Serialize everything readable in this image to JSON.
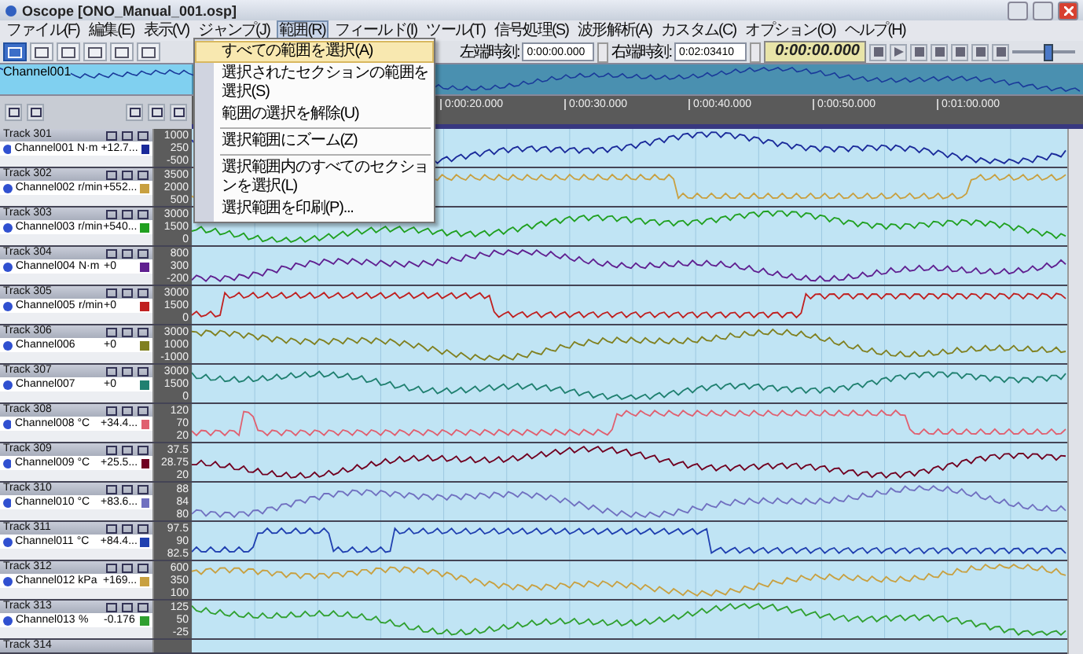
{
  "window": {
    "title": "Oscope [ONO_Manual_001.osp]"
  },
  "menu": [
    {
      "label": "ファイル(F)",
      "selected": false
    },
    {
      "label": "編集(E)",
      "selected": false
    },
    {
      "label": "表示(V)",
      "selected": false
    },
    {
      "label": "ジャンプ(J)",
      "selected": false
    },
    {
      "label": "範囲(R)",
      "selected": true
    },
    {
      "label": "フィールド(I)",
      "selected": false
    },
    {
      "label": "ツール(T)",
      "selected": false
    },
    {
      "label": "信号処理(S)",
      "selected": false
    },
    {
      "label": "波形解析(A)",
      "selected": false
    },
    {
      "label": "カスタム(C)",
      "selected": false
    },
    {
      "label": "オプション(O)",
      "selected": false
    },
    {
      "label": "ヘルプ(H)",
      "selected": false
    }
  ],
  "dropdown": [
    {
      "kind": "item",
      "label": "すべての範囲を選択(A)",
      "selected": true
    },
    {
      "kind": "item",
      "label": "選択されたセクションの範囲を選択(S)",
      "selected": false
    },
    {
      "kind": "item",
      "label": "範囲の選択を解除(U)",
      "selected": false
    },
    {
      "kind": "separator"
    },
    {
      "kind": "item",
      "label": "選択範囲にズーム(Z)",
      "selected": false
    },
    {
      "kind": "separator"
    },
    {
      "kind": "item",
      "label": "選択範囲内のすべてのセクションを選択(L)",
      "selected": false
    },
    {
      "kind": "item",
      "label": "選択範囲を印刷(P)...",
      "selected": false
    }
  ],
  "toolbar": {
    "tools": [
      {
        "selected": true
      },
      {
        "selected": false
      },
      {
        "selected": false
      },
      {
        "selected": false
      },
      {
        "selected": false
      },
      {
        "selected": false
      }
    ],
    "left_time_label": "左端時刻:",
    "left_time": "0:00:00.000",
    "right_time_label": "右端時刻:",
    "right_time": "0:02:03410",
    "timer": "0:00:00.000",
    "zoom": {
      "level": 0.55
    }
  },
  "overview": {
    "label": "Channel001"
  },
  "timeline": {
    "labels": [
      "0:00:20.000",
      "0:00:30.000",
      "0:00:40.000",
      "0:00:50.000",
      "0:01:00.000"
    ]
  },
  "tracks": [
    {
      "name": "Track 301",
      "channel": "Channel001",
      "unit": "N·m",
      "value": "+12.7...",
      "color": "#1a2a9a",
      "ticks": [
        "1000",
        "250",
        "-500"
      ]
    },
    {
      "name": "Track 302",
      "channel": "Channel002",
      "unit": "r/min",
      "value": "+552...",
      "color": "#c8a040",
      "ticks": [
        "3500",
        "2000",
        "500"
      ]
    },
    {
      "name": "Track 303",
      "channel": "Channel003",
      "unit": "r/min",
      "value": "+540...",
      "color": "#20a020",
      "ticks": [
        "3000",
        "1500",
        "0"
      ]
    },
    {
      "name": "Track 304",
      "channel": "Channel004",
      "unit": "N·m",
      "value": "+0",
      "color": "#602090",
      "ticks": [
        "800",
        "300",
        "-200"
      ]
    },
    {
      "name": "Track 305",
      "channel": "Channel005",
      "unit": "r/min",
      "value": "+0",
      "color": "#c02020",
      "ticks": [
        "3000",
        "1500",
        "0"
      ]
    },
    {
      "name": "Track 306",
      "channel": "Channel006",
      "value": "+0",
      "color": "#808020",
      "ticks": [
        "3000",
        "1000",
        "-1000"
      ]
    },
    {
      "name": "Track 307",
      "channel": "Channel007",
      "value": "+0",
      "color": "#208070",
      "ticks": [
        "3000",
        "1500",
        "0"
      ]
    },
    {
      "name": "Track 308",
      "channel": "Channel008",
      "unit": "°C",
      "value": "+34.4...",
      "color": "#e06070",
      "ticks": [
        "120",
        "70",
        "20"
      ]
    },
    {
      "name": "Track 309",
      "channel": "Channel009",
      "unit": "°C",
      "value": "+25.5...",
      "color": "#700020",
      "ticks": [
        "37.5",
        "28.75",
        "20"
      ]
    },
    {
      "name": "Track 310",
      "channel": "Channel010",
      "unit": "°C",
      "value": "+83.6...",
      "color": "#7070c0",
      "ticks": [
        "88",
        "84",
        "80"
      ]
    },
    {
      "name": "Track 311",
      "channel": "Channel011",
      "unit": "°C",
      "value": "+84.4...",
      "color": "#2040b0",
      "ticks": [
        "97.5",
        "90",
        "82.5"
      ]
    },
    {
      "name": "Track 312",
      "channel": "Channel012",
      "unit": "kPa",
      "value": "+169...",
      "color": "#c8a040",
      "ticks": [
        "600",
        "350",
        "100"
      ]
    },
    {
      "name": "Track 313",
      "channel": "Channel013",
      "unit": "%",
      "value": "-0.176",
      "color": "#30a030",
      "ticks": [
        "125",
        "50",
        "-25"
      ]
    }
  ],
  "partial_track": {
    "name": "Track 314"
  }
}
